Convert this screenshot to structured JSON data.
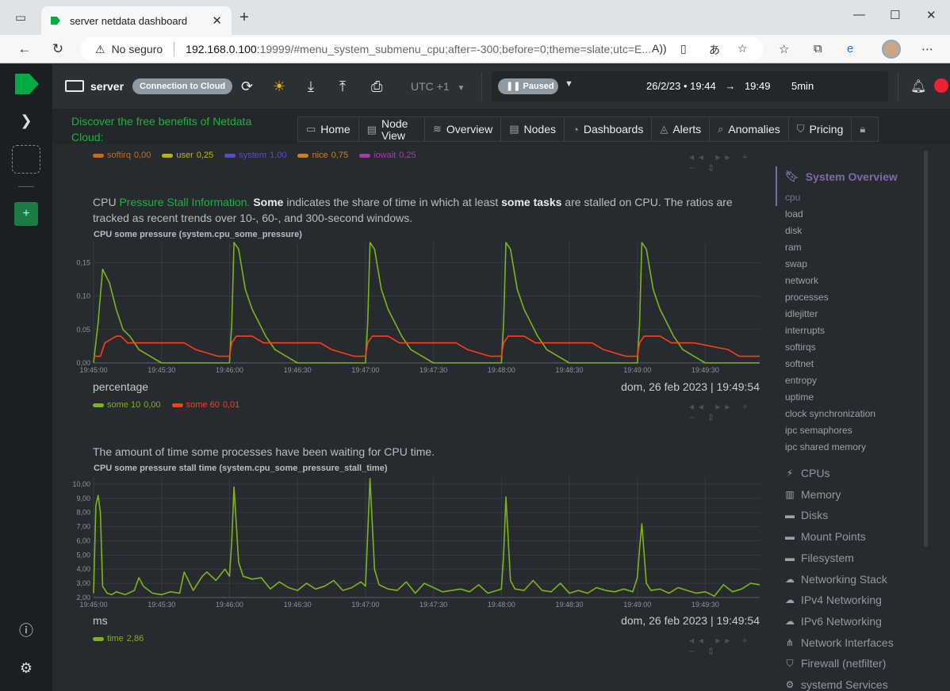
{
  "browser": {
    "tab_title": "server netdata dashboard",
    "security_label": "No seguro",
    "url_host": "192.168.0.100",
    "url_rest": ":19999/#menu_system_submenu_cpu;after=-300;before=0;theme=slate;utc=E..."
  },
  "header": {
    "server_name": "server",
    "connect_label": "Connection to Cloud",
    "timezone": "UTC +1",
    "paused_label": "Paused",
    "date": "26/2/23",
    "time_from": "19:44",
    "time_to": "19:49",
    "duration": "5min"
  },
  "promo": {
    "text": "Discover the free benefits of Netdata Cloud:"
  },
  "nav": [
    "Home",
    "Node View",
    "Overview",
    "Nodes",
    "Dashboards",
    "Alerts",
    "Anomalies",
    "Pricing"
  ],
  "top_legend": [
    {
      "name": "softirq",
      "value": "0,00",
      "color": "#ff7f0e"
    },
    {
      "name": "user",
      "value": "0,25",
      "color": "#e5e500"
    },
    {
      "name": "system",
      "value": "1,00",
      "color": "#5e5ef5"
    },
    {
      "name": "nice",
      "value": "0,75",
      "color": "#ff9f1e"
    },
    {
      "name": "iowait",
      "value": "0,25",
      "color": "#cc44cc"
    }
  ],
  "section1": {
    "desc_pre": "CPU ",
    "desc_link": "Pressure Stall Information.",
    "desc_b1": "Some",
    "desc_mid": " indicates the share of time in which at least ",
    "desc_b2": "some tasks",
    "desc_post": " are stalled on CPU. The ratios are tracked as recent trends over 10-, 60-, and 300-second windows."
  },
  "section2": {
    "desc": "The amount of time some processes have been waiting for CPU time."
  },
  "chart_data": [
    {
      "type": "line",
      "title": "CPU some pressure (system.cpu_some_pressure)",
      "units": "percentage",
      "timestamp": "dom, 26 feb 2023 | 19:49:54",
      "ylim": [
        0,
        0.18
      ],
      "yticks": [
        "0,00",
        "0,05",
        "0,10",
        "0,15"
      ],
      "ytick_values": [
        0,
        0.05,
        0.1,
        0.15
      ],
      "xticks": [
        "19:45:00",
        "19:45:30",
        "19:46:00",
        "19:46:30",
        "19:47:00",
        "19:47:30",
        "19:48:00",
        "19:48:30",
        "19:49:00",
        "19:49:30"
      ],
      "x_start": "19:45:00",
      "x_end": "19:49:54",
      "series": [
        {
          "name": "some 10",
          "legend_value": "0,00",
          "color": "#7cb518",
          "x": [
            0,
            2,
            4,
            7,
            10,
            13,
            16,
            20,
            25,
            30,
            40,
            50,
            60,
            61,
            62,
            64,
            67,
            70,
            73,
            76,
            80,
            85,
            90,
            100,
            110,
            120,
            121,
            122,
            124,
            127,
            130,
            133,
            136,
            140,
            145,
            150,
            160,
            170,
            180,
            181,
            182,
            184,
            187,
            190,
            193,
            196,
            200,
            205,
            210,
            220,
            230,
            240,
            241,
            242,
            244,
            247,
            250,
            253,
            256,
            260,
            265,
            270,
            280,
            294
          ],
          "y": [
            0.0,
            0.06,
            0.14,
            0.12,
            0.08,
            0.05,
            0.04,
            0.02,
            0.01,
            0.0,
            0.0,
            0.0,
            0.0,
            0.06,
            0.18,
            0.17,
            0.11,
            0.08,
            0.06,
            0.04,
            0.02,
            0.01,
            0.0,
            0.0,
            0.0,
            0.0,
            0.06,
            0.18,
            0.17,
            0.11,
            0.08,
            0.06,
            0.04,
            0.02,
            0.01,
            0.0,
            0.0,
            0.0,
            0.0,
            0.06,
            0.18,
            0.17,
            0.11,
            0.08,
            0.06,
            0.04,
            0.02,
            0.01,
            0.0,
            0.0,
            0.0,
            0.0,
            0.06,
            0.18,
            0.17,
            0.11,
            0.08,
            0.06,
            0.04,
            0.02,
            0.01,
            0.0,
            0.0,
            0.0
          ]
        },
        {
          "name": "some 60",
          "legend_value": "0,01",
          "color": "#ff3d17",
          "x": [
            0,
            3,
            5,
            10,
            12,
            15,
            25,
            40,
            45,
            55,
            60,
            61,
            63,
            70,
            75,
            85,
            100,
            105,
            115,
            120,
            121,
            123,
            130,
            135,
            145,
            160,
            165,
            175,
            180,
            181,
            183,
            190,
            195,
            205,
            220,
            225,
            235,
            240,
            241,
            243,
            250,
            255,
            265,
            280,
            285,
            294
          ],
          "y": [
            0.01,
            0.01,
            0.03,
            0.04,
            0.04,
            0.03,
            0.03,
            0.03,
            0.02,
            0.01,
            0.01,
            0.03,
            0.04,
            0.04,
            0.03,
            0.03,
            0.03,
            0.02,
            0.01,
            0.01,
            0.03,
            0.04,
            0.04,
            0.03,
            0.03,
            0.03,
            0.02,
            0.01,
            0.01,
            0.03,
            0.04,
            0.04,
            0.03,
            0.03,
            0.03,
            0.02,
            0.01,
            0.01,
            0.03,
            0.04,
            0.04,
            0.03,
            0.03,
            0.02,
            0.01,
            0.01
          ]
        }
      ]
    },
    {
      "type": "line",
      "title": "CPU some pressure stall time (system.cpu_some_pressure_stall_time)",
      "units": "ms",
      "timestamp": "dom, 26 feb 2023 | 19:49:54",
      "ylim": [
        2,
        10.5
      ],
      "yticks": [
        "2,00",
        "3,00",
        "4,00",
        "5,00",
        "6,00",
        "7,00",
        "8,00",
        "9,00",
        "10,00"
      ],
      "ytick_values": [
        2,
        3,
        4,
        5,
        6,
        7,
        8,
        9,
        10
      ],
      "xticks": [
        "19:45:00",
        "19:45:30",
        "19:46:00",
        "19:46:30",
        "19:47:00",
        "19:47:30",
        "19:48:00",
        "19:48:30",
        "19:49:00",
        "19:49:30"
      ],
      "x_start": "19:45:00",
      "x_end": "19:49:54",
      "series": [
        {
          "name": "time",
          "legend_value": "2,86",
          "color": "#7cb518",
          "x": [
            0,
            1,
            2,
            3,
            4,
            6,
            8,
            10,
            14,
            18,
            20,
            22,
            26,
            30,
            34,
            38,
            40,
            44,
            48,
            50,
            54,
            58,
            60,
            61,
            62,
            64,
            66,
            70,
            74,
            78,
            82,
            86,
            90,
            94,
            98,
            102,
            106,
            110,
            114,
            118,
            120,
            121,
            122,
            124,
            126,
            130,
            134,
            138,
            142,
            146,
            150,
            154,
            158,
            162,
            166,
            170,
            174,
            178,
            180,
            181,
            182,
            184,
            186,
            190,
            194,
            198,
            202,
            206,
            210,
            214,
            218,
            222,
            226,
            230,
            234,
            238,
            240,
            241,
            242,
            244,
            246,
            250,
            254,
            258,
            262,
            266,
            270,
            274,
            278,
            282,
            286,
            290,
            294
          ],
          "y": [
            2.3,
            8.5,
            9.2,
            8.0,
            2.8,
            2.3,
            2.2,
            2.4,
            2.2,
            2.5,
            3.4,
            2.8,
            2.3,
            2.2,
            2.4,
            2.3,
            3.8,
            2.5,
            3.5,
            3.8,
            3.2,
            4.0,
            3.5,
            6.0,
            9.8,
            4.5,
            3.5,
            3.3,
            3.4,
            2.6,
            3.1,
            2.7,
            2.5,
            3.0,
            2.6,
            2.8,
            3.2,
            2.5,
            2.7,
            3.1,
            2.8,
            6.5,
            10.4,
            4.0,
            2.9,
            2.6,
            2.5,
            3.1,
            2.3,
            3.0,
            2.7,
            2.4,
            2.5,
            2.6,
            2.4,
            2.9,
            2.3,
            2.5,
            2.6,
            5.0,
            9.1,
            3.2,
            2.6,
            2.5,
            3.2,
            2.5,
            2.4,
            3.0,
            2.3,
            2.5,
            2.3,
            2.7,
            2.5,
            2.4,
            2.6,
            2.4,
            3.4,
            5.5,
            7.2,
            3.0,
            2.5,
            2.6,
            2.3,
            2.7,
            2.5,
            2.3,
            2.4,
            2.1,
            2.9,
            2.4,
            2.6,
            3.0,
            2.9
          ]
        }
      ]
    }
  ],
  "sidebar": {
    "section_title": "System Overview",
    "submenu": [
      "cpu",
      "load",
      "disk",
      "ram",
      "swap",
      "network",
      "processes",
      "idlejitter",
      "interrupts",
      "softirqs",
      "softnet",
      "entropy",
      "uptime",
      "clock synchronization",
      "ipc semaphores",
      "ipc shared memory"
    ],
    "sections": [
      {
        "label": "CPUs",
        "icon": "bolt-icon"
      },
      {
        "label": "Memory",
        "icon": "memory-chip-icon"
      },
      {
        "label": "Disks",
        "icon": "hdd-icon"
      },
      {
        "label": "Mount Points",
        "icon": "hdd-icon"
      },
      {
        "label": "Filesystem",
        "icon": "hdd-icon"
      },
      {
        "label": "Networking Stack",
        "icon": "cloud-icon"
      },
      {
        "label": "IPv4 Networking",
        "icon": "cloud-icon"
      },
      {
        "label": "IPv6 Networking",
        "icon": "cloud-icon"
      },
      {
        "label": "Network Interfaces",
        "icon": "sitemap-icon"
      },
      {
        "label": "Firewall (netfilter)",
        "icon": "shield-icon"
      },
      {
        "label": "systemd Services",
        "icon": "gears-icon"
      }
    ]
  }
}
